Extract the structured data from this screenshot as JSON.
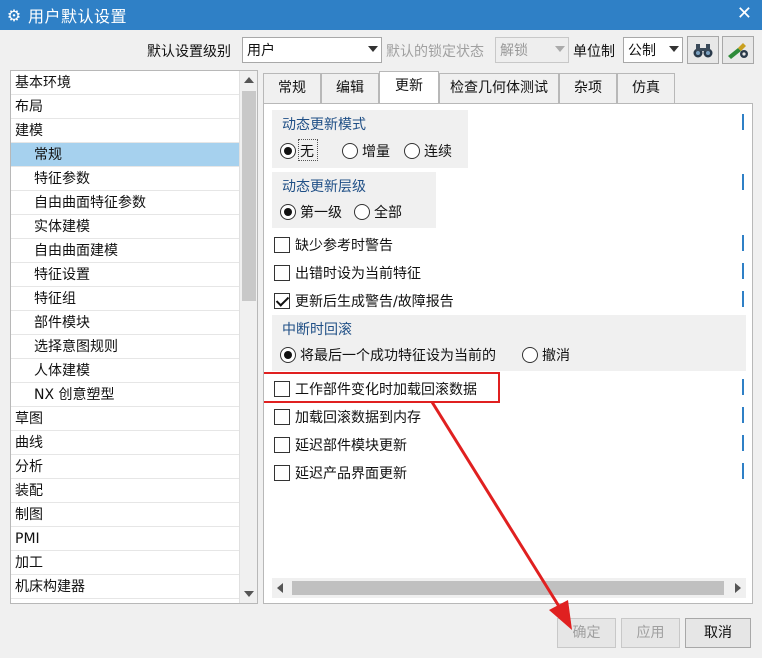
{
  "window": {
    "title": "用户默认设置"
  },
  "toolbar": {
    "level_label": "默认设置级别",
    "level_value": "用户",
    "lock_label": "默认的锁定状态",
    "lock_value": "解锁",
    "unit_label": "单位制",
    "unit_value": "公制"
  },
  "tree": {
    "items": [
      {
        "label": "基本环境",
        "child": false
      },
      {
        "label": "布局",
        "child": false
      },
      {
        "label": "建模",
        "child": false
      },
      {
        "label": "常规",
        "child": true,
        "selected": true
      },
      {
        "label": "特征参数",
        "child": true
      },
      {
        "label": "自由曲面特征参数",
        "child": true
      },
      {
        "label": "实体建模",
        "child": true
      },
      {
        "label": "自由曲面建模",
        "child": true
      },
      {
        "label": "特征设置",
        "child": true
      },
      {
        "label": "特征组",
        "child": true
      },
      {
        "label": "部件模块",
        "child": true
      },
      {
        "label": "选择意图规则",
        "child": true
      },
      {
        "label": "人体建模",
        "child": true
      },
      {
        "label": "NX 创意塑型",
        "child": true
      },
      {
        "label": "草图",
        "child": false
      },
      {
        "label": "曲线",
        "child": false
      },
      {
        "label": "分析",
        "child": false
      },
      {
        "label": "装配",
        "child": false
      },
      {
        "label": "制图",
        "child": false
      },
      {
        "label": "PMI",
        "child": false
      },
      {
        "label": "加工",
        "child": false
      },
      {
        "label": "机床构建器",
        "child": false
      }
    ]
  },
  "tabs": [
    "常规",
    "编辑",
    "更新",
    "检查几何体测试",
    "杂项",
    "仿真"
  ],
  "active_tab": "更新",
  "groups": {
    "dynamic_mode": {
      "title": "动态更新模式",
      "options": [
        "无",
        "增量",
        "连续"
      ],
      "selected": "无"
    },
    "dynamic_level": {
      "title": "动态更新层级",
      "options": [
        "第一级",
        "全部"
      ],
      "selected": "第一级"
    },
    "interrupt": {
      "title": "中断时回滚",
      "options": [
        "将最后一个成功特征设为当前的",
        "撤消"
      ],
      "selected": "将最后一个成功特征设为当前的"
    }
  },
  "checkboxes": {
    "missing_ref": {
      "label": "缺少参考时警告",
      "checked": false
    },
    "error_current": {
      "label": "出错时设为当前特征",
      "checked": false
    },
    "after_update": {
      "label": "更新后生成警告/故障报告",
      "checked": true
    },
    "load_rollback": {
      "label": "工作部件变化时加载回滚数据",
      "checked": false
    },
    "rollback_memory": {
      "label": "加载回滚数据到内存",
      "checked": false
    },
    "delay_module": {
      "label": "延迟部件模块更新",
      "checked": false
    },
    "delay_product": {
      "label": "延迟产品界面更新",
      "checked": false
    }
  },
  "buttons": {
    "ok": "确定",
    "apply": "应用",
    "cancel": "取消"
  },
  "colors": {
    "titlebar": "#2f80c6",
    "selection": "#a6d1ee",
    "highlight_box": "#e02020",
    "group_title": "#1f4f86"
  },
  "icons": [
    "gear-icon",
    "close-icon",
    "binoculars-icon",
    "settings-edit-icon"
  ]
}
